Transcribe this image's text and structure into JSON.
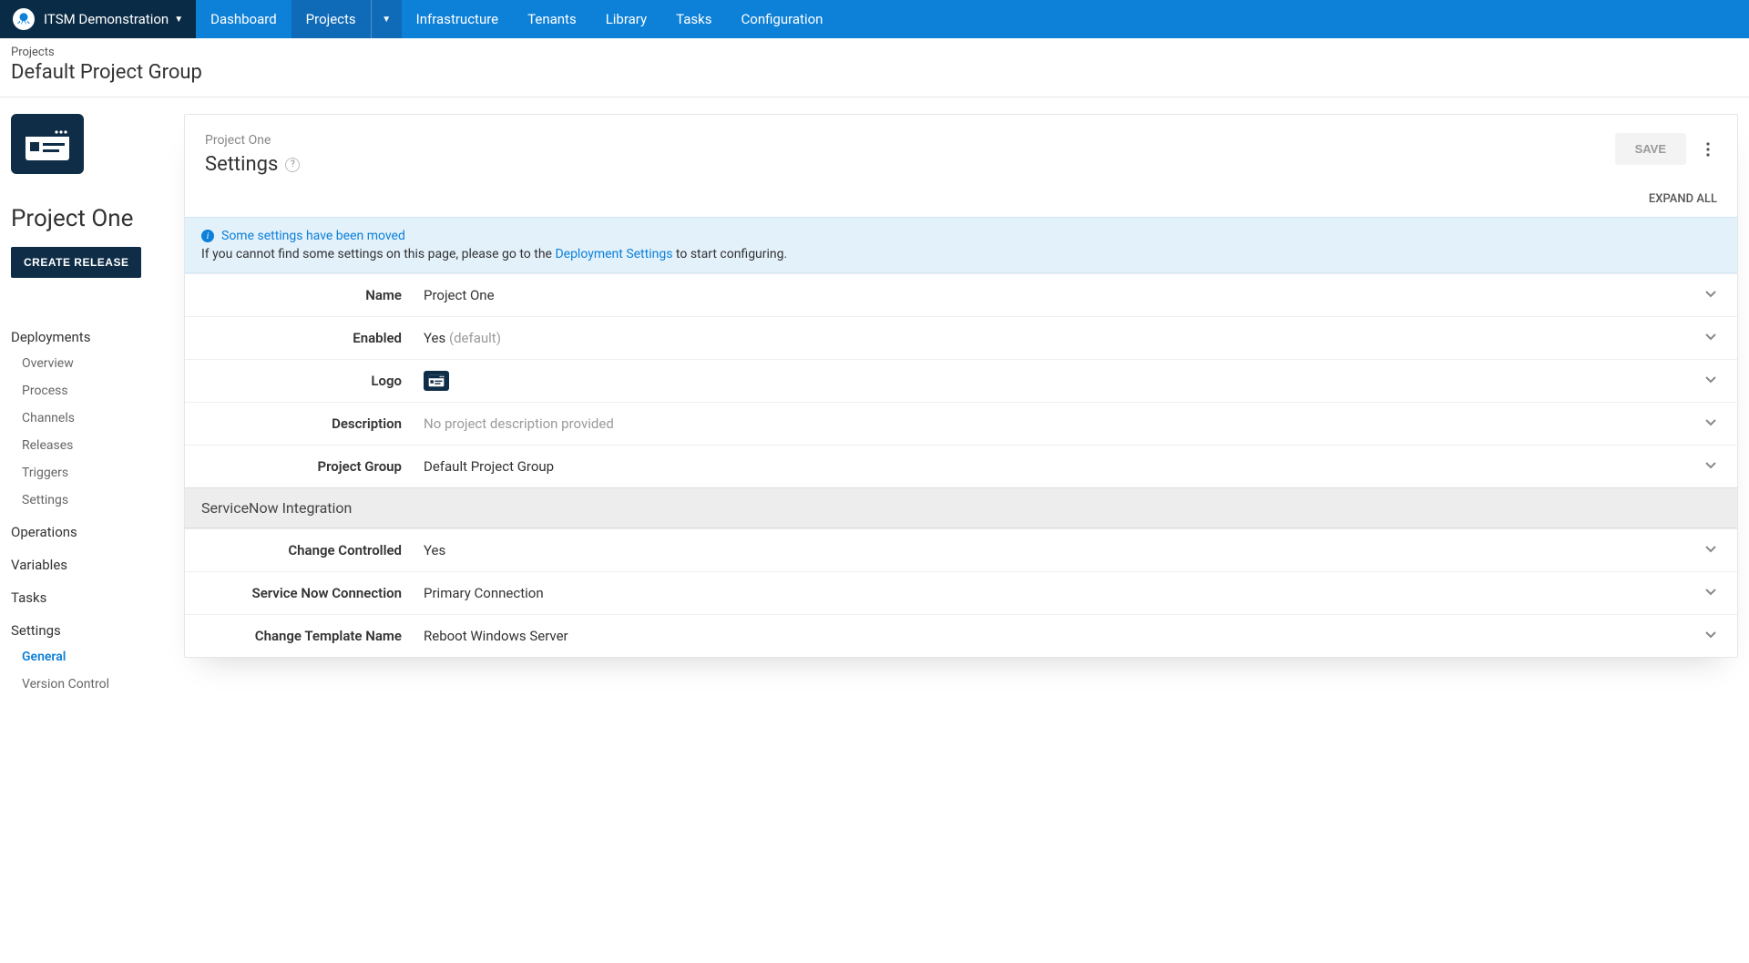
{
  "brand": {
    "name": "ITSM Demonstration"
  },
  "nav": {
    "items": [
      {
        "label": "Dashboard"
      },
      {
        "label": "Projects"
      },
      {
        "label": "Infrastructure"
      },
      {
        "label": "Tenants"
      },
      {
        "label": "Library"
      },
      {
        "label": "Tasks"
      },
      {
        "label": "Configuration"
      }
    ]
  },
  "breadcrumb": {
    "parent": "Projects",
    "title": "Default Project Group"
  },
  "sidebar": {
    "project_name": "Project One",
    "create_release": "CREATE RELEASE",
    "sections": {
      "deployments": "Deployments",
      "overview": "Overview",
      "process": "Process",
      "channels": "Channels",
      "releases": "Releases",
      "triggers": "Triggers",
      "settings": "Settings",
      "operations": "Operations",
      "variables": "Variables",
      "tasks": "Tasks",
      "settings2": "Settings",
      "general": "General",
      "version_control": "Version Control"
    }
  },
  "content": {
    "header_project": "Project One",
    "header_title": "Settings",
    "save": "SAVE",
    "expand_all": "EXPAND ALL",
    "banner": {
      "title": "Some settings have been moved",
      "body_pre": "If you cannot find some settings on this page, please go to the ",
      "body_link": "Deployment Settings",
      "body_post": " to start configuring."
    },
    "rows": {
      "name": {
        "label": "Name",
        "value": "Project One"
      },
      "enabled": {
        "label": "Enabled",
        "value": "Yes",
        "suffix": " (default)"
      },
      "logo": {
        "label": "Logo"
      },
      "description": {
        "label": "Description",
        "placeholder": "No project description provided"
      },
      "project_group": {
        "label": "Project Group",
        "value": "Default Project Group"
      }
    },
    "section": "ServiceNow Integration",
    "snow": {
      "change_controlled": {
        "label": "Change Controlled",
        "value": "Yes"
      },
      "connection": {
        "label": "Service Now Connection",
        "value": "Primary Connection"
      },
      "template": {
        "label": "Change Template Name",
        "value": "Reboot Windows Server"
      }
    }
  }
}
